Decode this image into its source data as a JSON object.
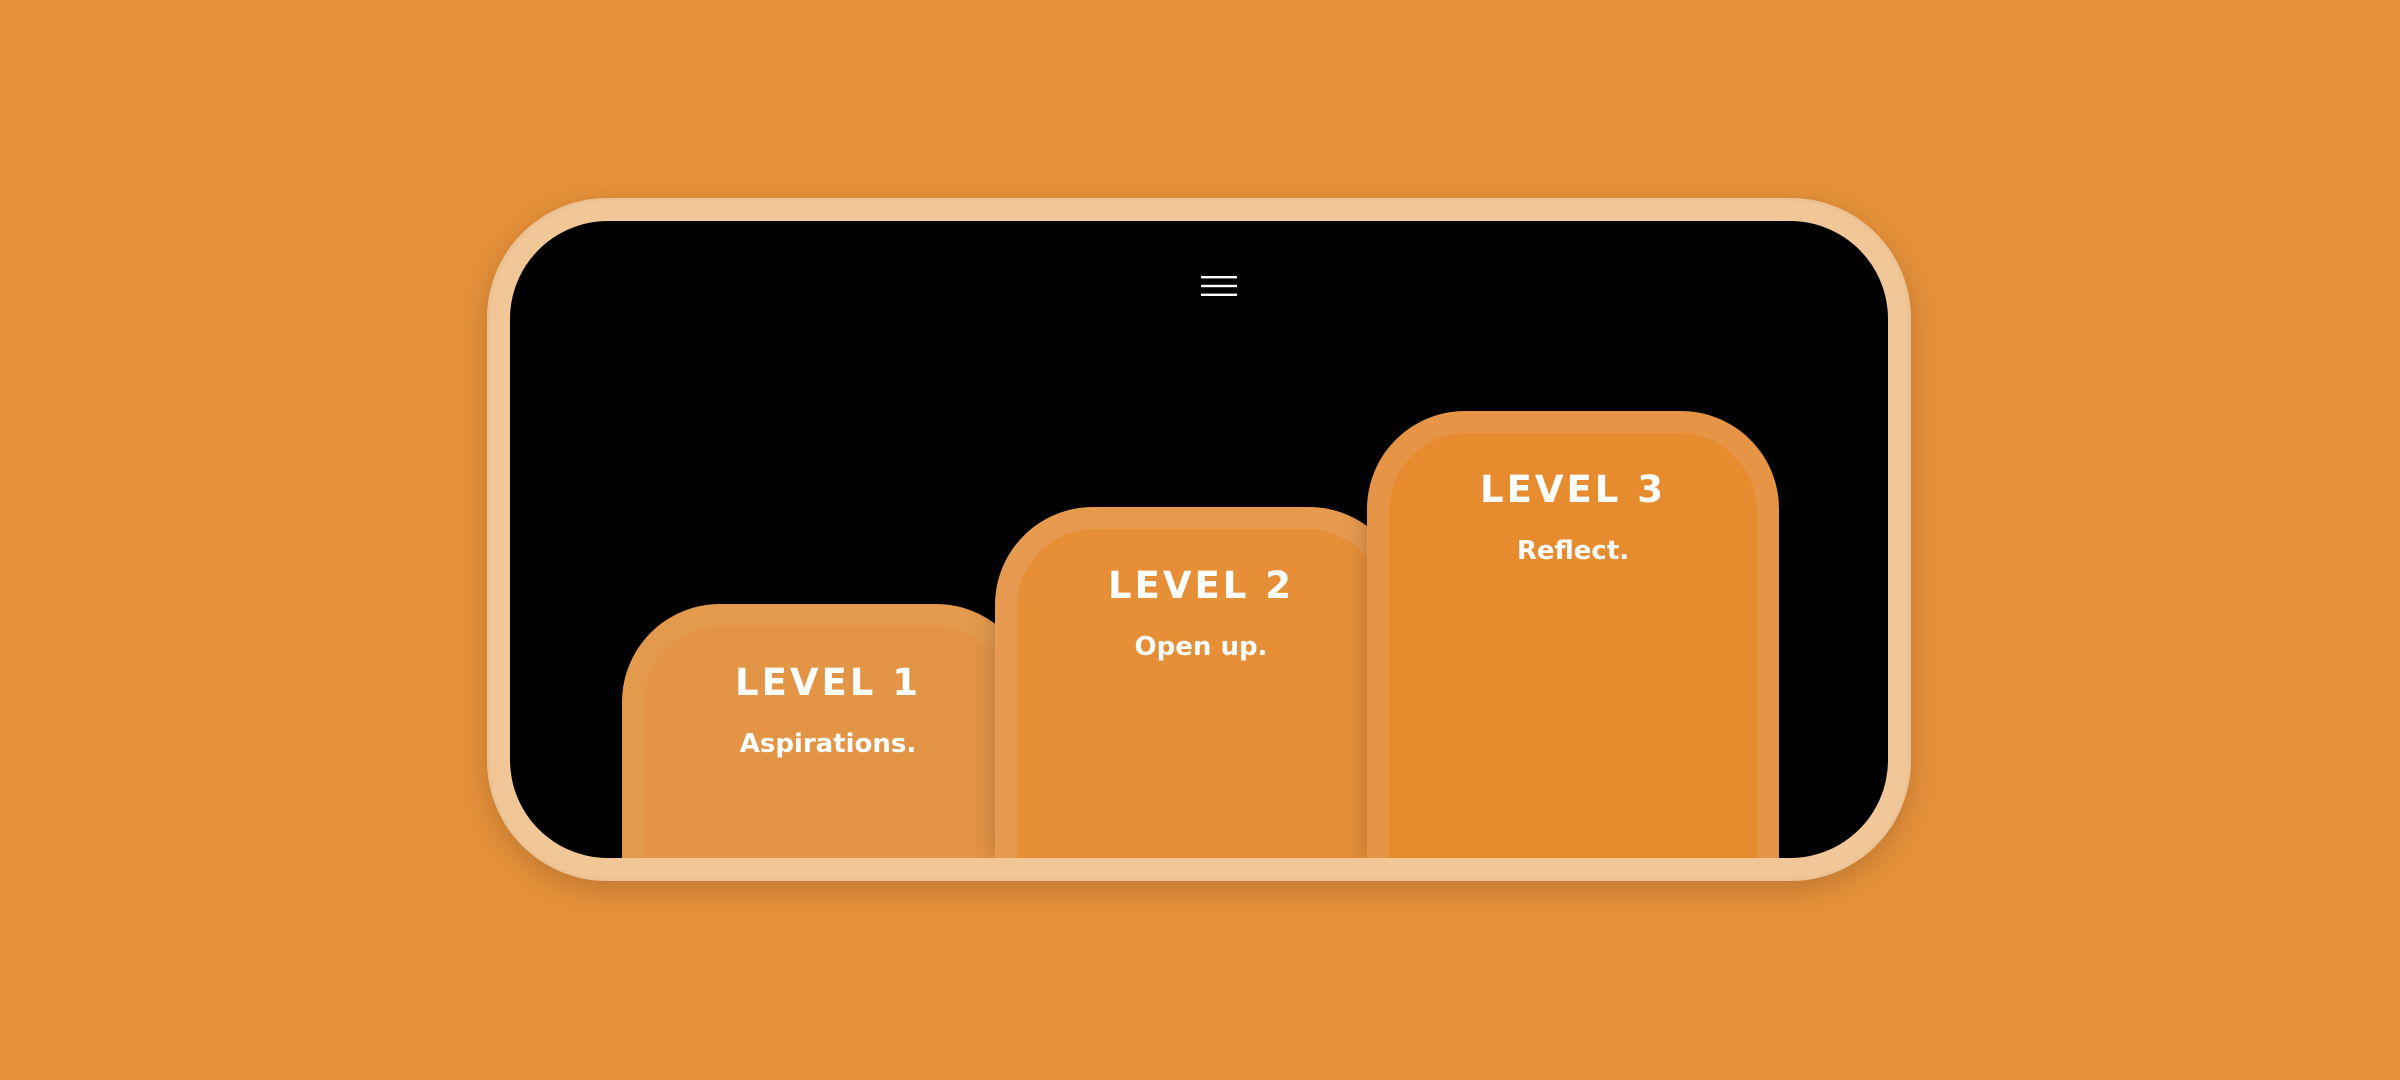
{
  "colors": {
    "background": "#e6913a",
    "frame": "#f1c797",
    "screen": "#000000",
    "text": "#ffffff"
  },
  "header": {
    "menu_icon": "hamburger-menu-icon"
  },
  "levels": [
    {
      "title": "LEVEL 1",
      "subtitle": "Aspirations."
    },
    {
      "title": "LEVEL 2",
      "subtitle": "Open up."
    },
    {
      "title": "LEVEL 3",
      "subtitle": "Reflect."
    }
  ]
}
